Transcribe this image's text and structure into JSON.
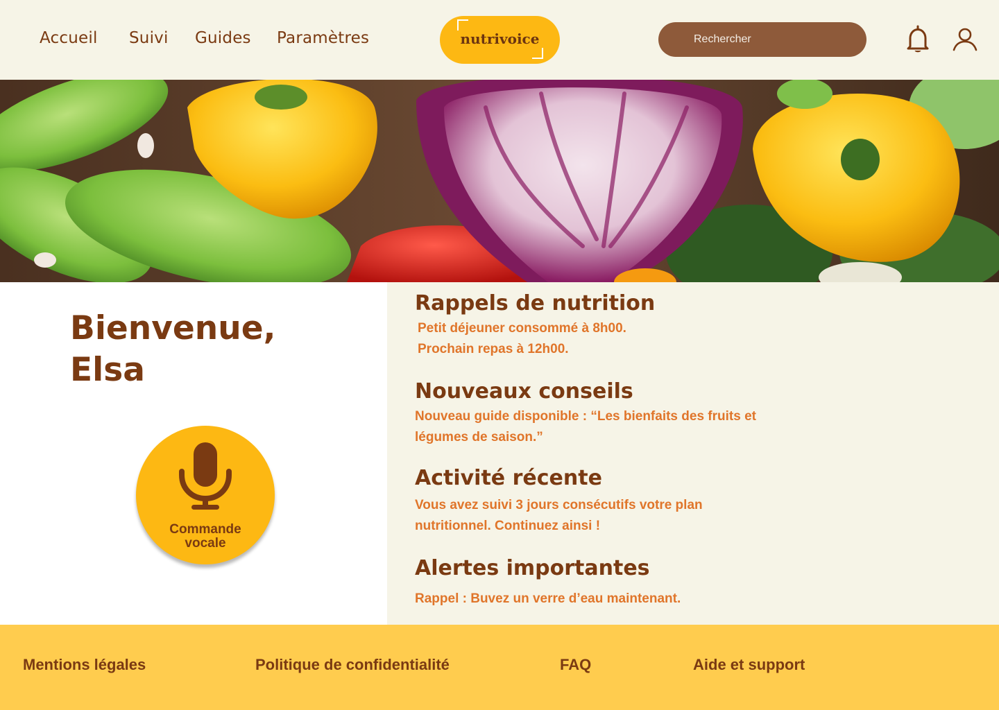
{
  "nav": {
    "items": [
      {
        "label": "Accueil"
      },
      {
        "label": "Suivi"
      },
      {
        "label": "Guides"
      },
      {
        "label": "Paramètres"
      }
    ]
  },
  "logo": {
    "text": "nutrivoice"
  },
  "search": {
    "placeholder": "Rechercher"
  },
  "header_icons": {
    "notifications": "bell-icon",
    "profile": "user-icon"
  },
  "welcome": {
    "line1": "Bienvenue,",
    "line2": "Elsa"
  },
  "voice_button": {
    "line1": "Commande",
    "line2": "vocale",
    "icon": "microphone-icon"
  },
  "sections": {
    "reminders": {
      "title": "Rappels de nutrition",
      "lines": [
        "Petit déjeuner consommé à 8h00.",
        "Prochain repas à 12h00."
      ]
    },
    "tips": {
      "title": "Nouveaux conseils",
      "lines": [
        "Nouveau guide disponible : “Les bienfaits des fruits et",
        "légumes de saison.”"
      ]
    },
    "activity": {
      "title": "Activité récente",
      "lines": [
        "Vous avez suivi 3 jours consécutifs votre plan",
        "nutritionnel. Continuez ainsi !"
      ]
    },
    "alerts": {
      "title": "Alertes importantes",
      "lines": [
        "Rappel : Buvez un verre d’eau maintenant."
      ]
    }
  },
  "footer": {
    "links": [
      "Mentions légales",
      "Politique de confidentialité",
      "FAQ",
      "Aide et support"
    ]
  },
  "colors": {
    "brown": "#7A3A12",
    "orange_text": "#E0752A",
    "yellow": "#FDB813",
    "footer_yellow": "#FFCC4E",
    "cream": "#F6F4E7",
    "search_brown": "#8E5A3A"
  }
}
